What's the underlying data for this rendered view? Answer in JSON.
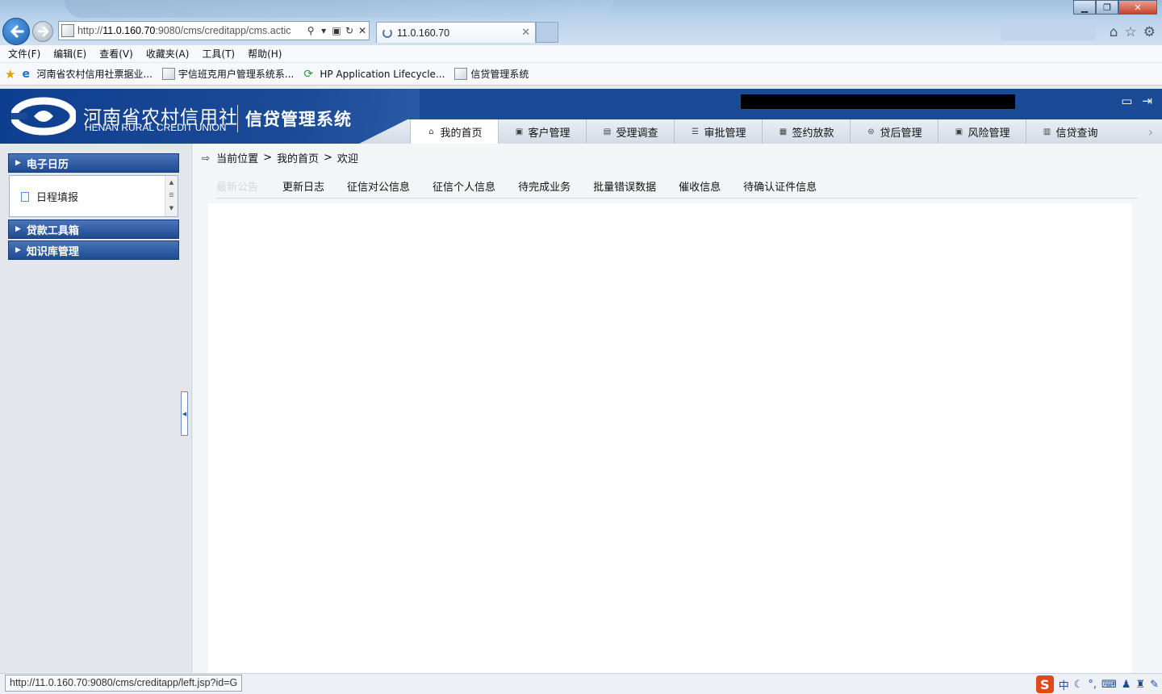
{
  "browser": {
    "address_url_prefix": "http://",
    "address_url_host": "11.0.160.70",
    "address_url_rest": ":9080/cms/creditapp/cms.actic",
    "active_tab_label": "11.0.160.70",
    "menu": [
      "文件(F)",
      "编辑(E)",
      "查看(V)",
      "收藏夹(A)",
      "工具(T)",
      "帮助(H)"
    ],
    "favorites": [
      {
        "label": "河南省农村信用社票据业...",
        "icon": "page-icon"
      },
      {
        "label": "宇信班克用户管理系统系...",
        "icon": "page-icon"
      },
      {
        "label": "HP Application Lifecycle...",
        "icon": "hp-icon"
      },
      {
        "label": "信贷管理系统",
        "icon": "page-icon"
      }
    ],
    "status_url": "http://11.0.160.70:9080/cms/creditapp/left.jsp?id=G"
  },
  "app": {
    "org_name_cn": "河南省农村信用社",
    "org_name_en": "HENAN RURAL CREDIT UNION",
    "system_title": "信贷管理系统",
    "nav": [
      {
        "label": "我的首页",
        "icon": "home-icon",
        "glyph": "⌂",
        "active": true
      },
      {
        "label": "客户管理",
        "icon": "customer-icon",
        "glyph": "▣",
        "active": false
      },
      {
        "label": "受理调查",
        "icon": "survey-icon",
        "glyph": "▤",
        "active": false
      },
      {
        "label": "审批管理",
        "icon": "approval-icon",
        "glyph": "☰",
        "active": false
      },
      {
        "label": "签约放款",
        "icon": "contract-icon",
        "glyph": "▦",
        "active": false
      },
      {
        "label": "贷后管理",
        "icon": "postloan-icon",
        "glyph": "⊜",
        "active": false
      },
      {
        "label": "风险管理",
        "icon": "risk-icon",
        "glyph": "▣",
        "active": false
      },
      {
        "label": "信贷查询",
        "icon": "query-icon",
        "glyph": "▥",
        "active": false
      }
    ]
  },
  "sidebar": {
    "groups": [
      {
        "label": "电子日历",
        "expanded": true,
        "items": [
          "日程填报"
        ]
      },
      {
        "label": "贷款工具箱",
        "expanded": false
      },
      {
        "label": "知识库管理",
        "expanded": false
      }
    ]
  },
  "breadcrumb": {
    "label": "当前位置",
    "sep": ">",
    "items": [
      "我的首页",
      "欢迎"
    ]
  },
  "sub_tabs": [
    "最新公告",
    "更新日志",
    "征信对公信息",
    "征信个人信息",
    "待完成业务",
    "批量错误数据",
    "催收信息",
    "待确认证件信息"
  ],
  "ime": {
    "label": "中"
  },
  "colors": {
    "header_blue": "#1b4b97",
    "sidebar_header": "#1d4a91"
  }
}
